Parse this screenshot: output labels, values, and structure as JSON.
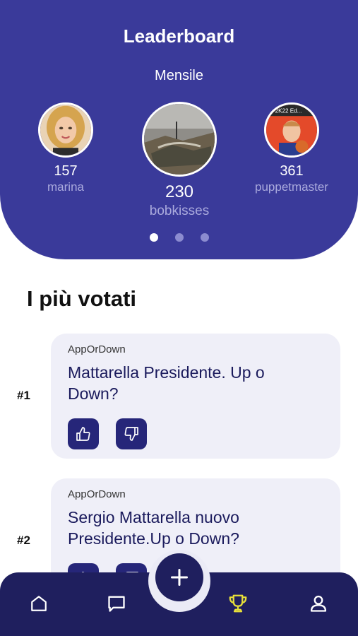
{
  "header": {
    "title": "Leaderboard",
    "period": "Mensile"
  },
  "leaderboard": [
    {
      "score": "157",
      "name": "marina"
    },
    {
      "score": "230",
      "name": "bobkisses"
    },
    {
      "score": "361",
      "name": "puppetmaster"
    }
  ],
  "avatar_badge_text": "2K22 Ed...",
  "section_title": "I più votati",
  "posts": [
    {
      "rank": "#1",
      "source": "AppOrDown",
      "text": "Mattarella Presidente. Up o Down?"
    },
    {
      "rank": "#2",
      "source": "AppOrDown",
      "text": "Sergio Mattarella nuovo Presidente.Up o Down?"
    }
  ],
  "nav": {
    "items": [
      "home-icon",
      "chat-icon",
      "trophy-icon",
      "profile-icon"
    ],
    "active": "trophy-icon",
    "fab": "plus-icon"
  },
  "colors": {
    "header_bg": "#3a3a9a",
    "nav_bg": "#1f1f5e",
    "card_bg": "#efeff8",
    "active_icon": "#e8e03a",
    "vote_button": "#262679"
  }
}
